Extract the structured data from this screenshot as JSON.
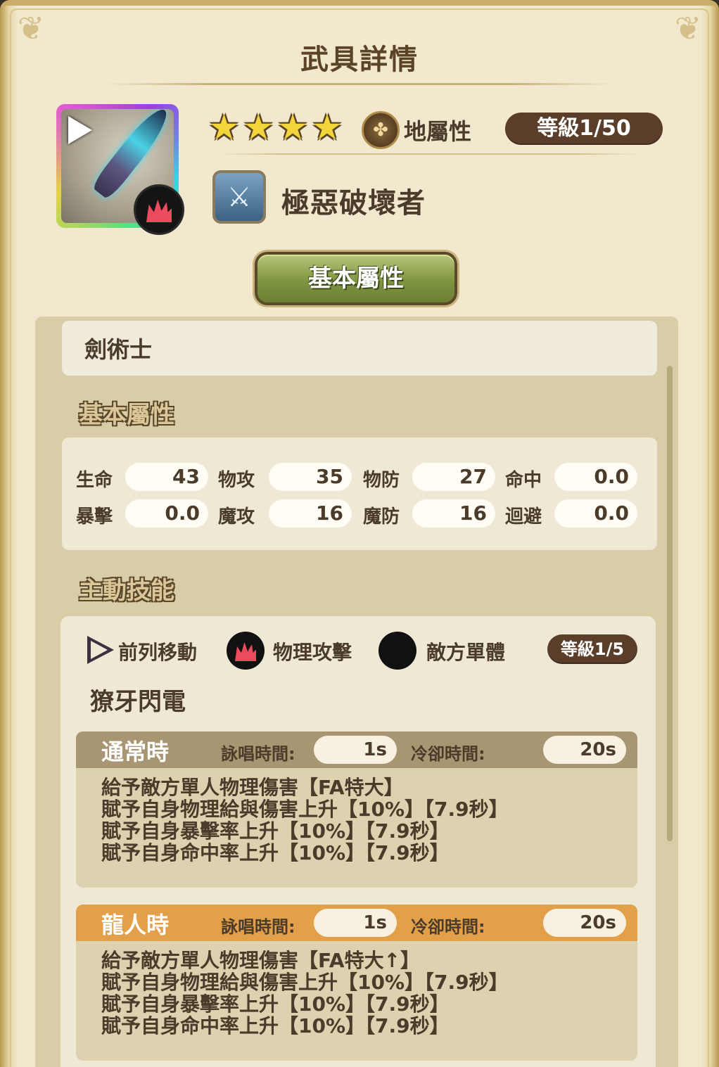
{
  "title": "武具詳情",
  "weapon": {
    "name": "極惡破壞者",
    "element": "地屬性",
    "level": "等級1/50",
    "stars": [
      "★",
      "★",
      "★",
      "★"
    ]
  },
  "tab": "基本屬性",
  "class_name": "劍術士",
  "sections": {
    "basic": "基本屬性",
    "active": "主動技能"
  },
  "stats": [
    {
      "label": "生命",
      "value": "43"
    },
    {
      "label": "物攻",
      "value": "35"
    },
    {
      "label": "物防",
      "value": "27"
    },
    {
      "label": "命中",
      "value": "0.0"
    },
    {
      "label": "暴擊",
      "value": "0.0"
    },
    {
      "label": "魔攻",
      "value": "16"
    },
    {
      "label": "魔防",
      "value": "16"
    },
    {
      "label": "迴避",
      "value": "0.0"
    }
  ],
  "skill": {
    "tags": [
      "前列移動",
      "物理攻擊",
      "敵方單體"
    ],
    "level": "等級1/5",
    "name": "獠牙閃電",
    "modes": [
      {
        "title": "通常時",
        "cast_label": "詠唱時間:",
        "cast_value": "1s",
        "cd_label": "冷卻時間:",
        "cd_value": "20s",
        "color": "#a89572",
        "lines": [
          "給予敵方單人物理傷害【FA特大】",
          "賦予自身物理給與傷害上升【10%】【7.9秒】",
          "賦予自身暴擊率上升【10%】【7.9秒】",
          "賦予自身命中率上升【10%】【7.9秒】"
        ]
      },
      {
        "title": "龍人時",
        "cast_label": "詠唱時間:",
        "cast_value": "1s",
        "cd_label": "冷卻時間:",
        "cd_value": "20s",
        "color": "#e3a04a",
        "lines": [
          "給予敵方單人物理傷害【FA特大↑】",
          "賦予自身物理給與傷害上升【10%】【7.9秒】",
          "賦予自身暴擊率上升【10%】【7.9秒】",
          "賦予自身命中率上升【10%】【7.9秒】"
        ]
      }
    ]
  },
  "icons": {
    "play": "play-icon",
    "attack": "physical-attack-icon",
    "element": "earth-element-icon",
    "weapon_type": "sword-type-icon",
    "target": "single-enemy-icon"
  }
}
